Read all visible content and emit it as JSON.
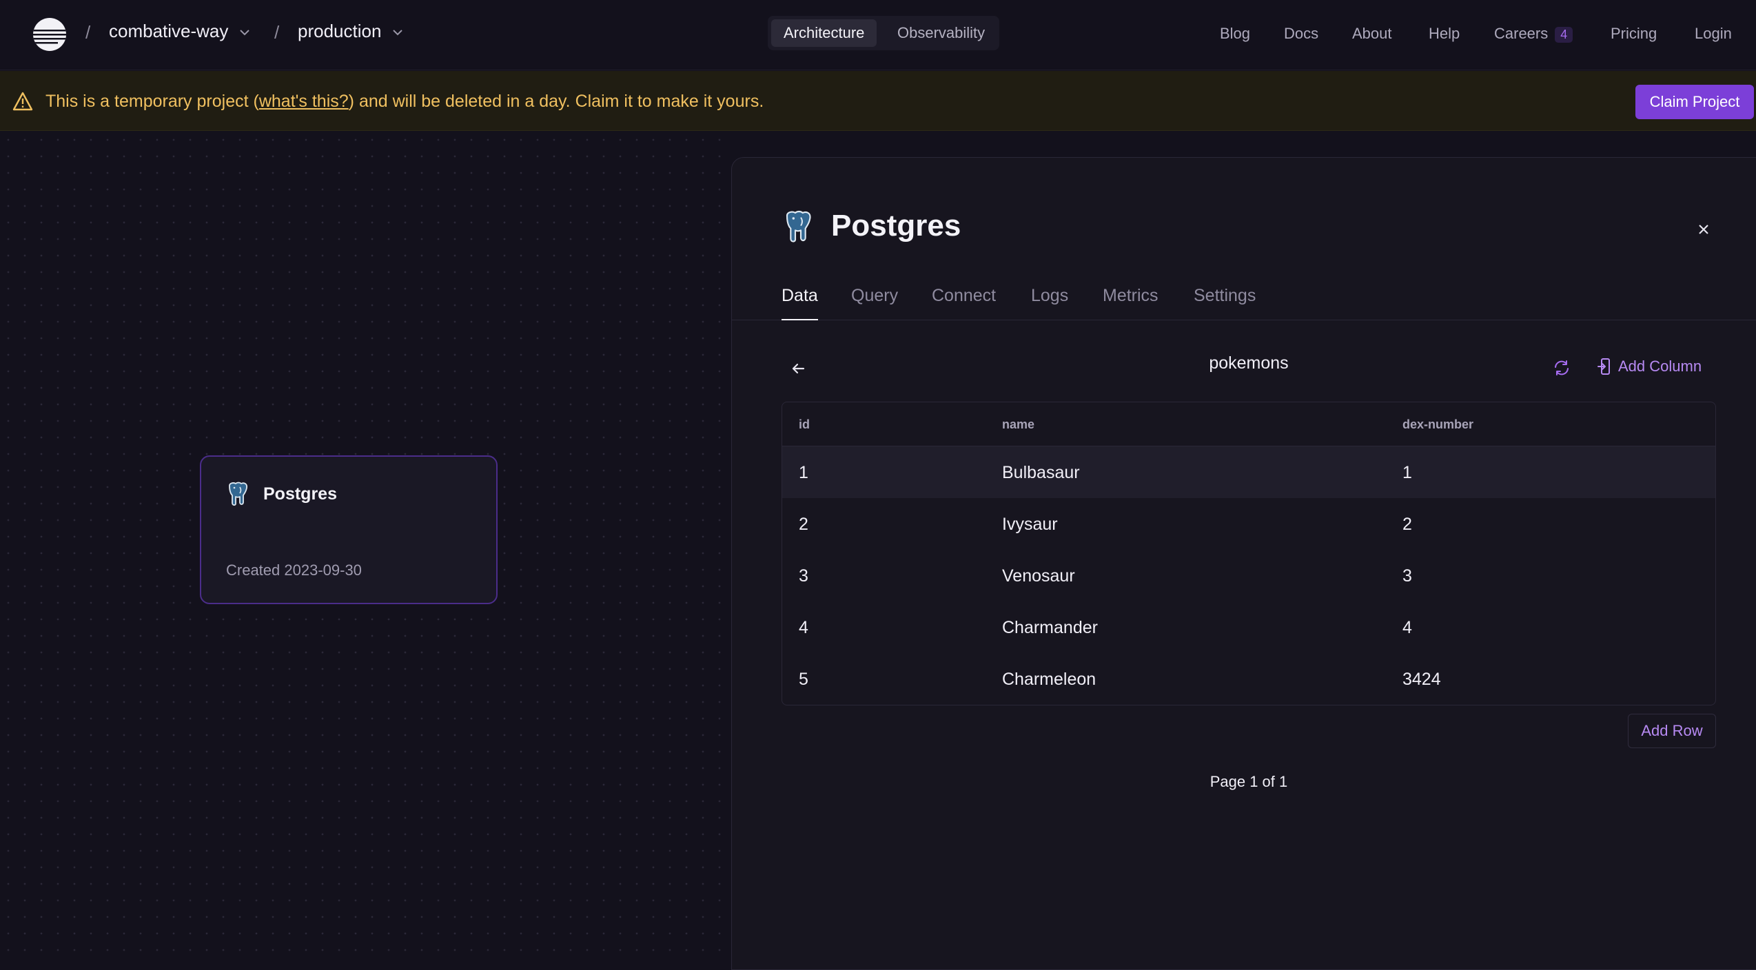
{
  "nav": {
    "project": "combative-way",
    "environment": "production",
    "separator": "/",
    "segments": [
      "Architecture",
      "Observability"
    ],
    "links": {
      "blog": "Blog",
      "docs": "Docs",
      "about": "About",
      "help": "Help",
      "careers": "Careers",
      "careers_count": "4",
      "pricing": "Pricing",
      "login": "Login"
    }
  },
  "banner": {
    "text_before": "This is a temporary project (",
    "link_text": "what's this?",
    "text_after": ") and will be deleted in a day. Claim it to make it yours.",
    "claim_label": "Claim Project"
  },
  "canvas": {
    "card": {
      "title": "Postgres",
      "created": "Created 2023-09-30"
    }
  },
  "panel": {
    "title": "Postgres",
    "tabs": [
      "Data",
      "Query",
      "Connect",
      "Logs",
      "Metrics",
      "Settings"
    ],
    "active_tab": "Data",
    "table_name": "pokemons",
    "add_column_label": "Add Column",
    "columns": [
      "id",
      "name",
      "dex-number"
    ],
    "rows": [
      [
        "1",
        "Bulbasaur",
        "1"
      ],
      [
        "2",
        "Ivysaur",
        "2"
      ],
      [
        "3",
        "Venosaur",
        "3"
      ],
      [
        "4",
        "Charmander",
        "4"
      ],
      [
        "5",
        "Charmeleon",
        "3424"
      ]
    ],
    "add_row_label": "Add Row",
    "pagination": "Page 1 of 1"
  },
  "colors": {
    "accent": "#7c3fd8",
    "warning": "#f0c060",
    "background": "#13111c"
  }
}
